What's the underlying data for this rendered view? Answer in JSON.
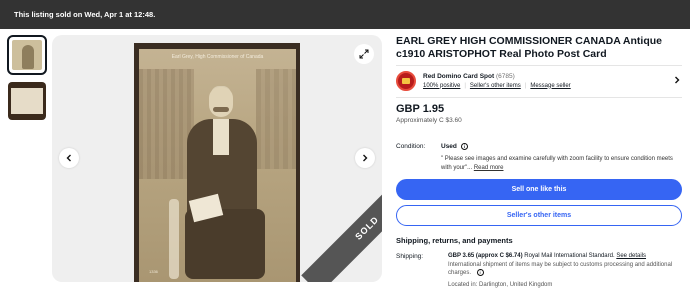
{
  "banner": {
    "text": "This listing sold on Wed, Apr 1 at 12:48."
  },
  "gallery": {
    "thumbnails": [
      "postcard-front",
      "postcard-back"
    ],
    "card_caption": "Earl Grey, High Commissioner of Canada",
    "card_number": "1336",
    "sold_label": "SOLD",
    "icons": {
      "expand": "expand-icon",
      "prev": "chevron-left-icon",
      "next": "chevron-right-icon"
    }
  },
  "listing": {
    "title": "EARL GREY HIGH COMMISSIONER CANADA Antique c1910 ARISTOPHOT Real Photo Post Card"
  },
  "seller": {
    "name": "Red Domino Card Spot",
    "feedback_count": "(6785)",
    "positive": "100% positive",
    "other_items": "Seller's other items",
    "message": "Message seller"
  },
  "price": {
    "amount": "GBP 1.95",
    "approx": "Approximately C $3.60"
  },
  "condition": {
    "label": "Condition:",
    "value": "Used",
    "description": "\" Please see images and examine carefully with zoom facility to ensure condition meets with your\"...",
    "read_more": "Read more"
  },
  "actions": {
    "sell_one": "Sell one like this",
    "other_items": "Seller's other items"
  },
  "shipping": {
    "heading": "Shipping, returns, and payments",
    "label": "Shipping:",
    "cost": "GBP 3.65 (approx C $6.74)",
    "service": "Royal Mail International Standard.",
    "details_link": "See details",
    "intl_note": "International shipment of items may be subject to customs processing and additional charges.",
    "location": "Located in: Darlington, United Kingdom"
  },
  "colors": {
    "accent": "#3665f3",
    "banner": "#333333",
    "sold": "#555555"
  }
}
